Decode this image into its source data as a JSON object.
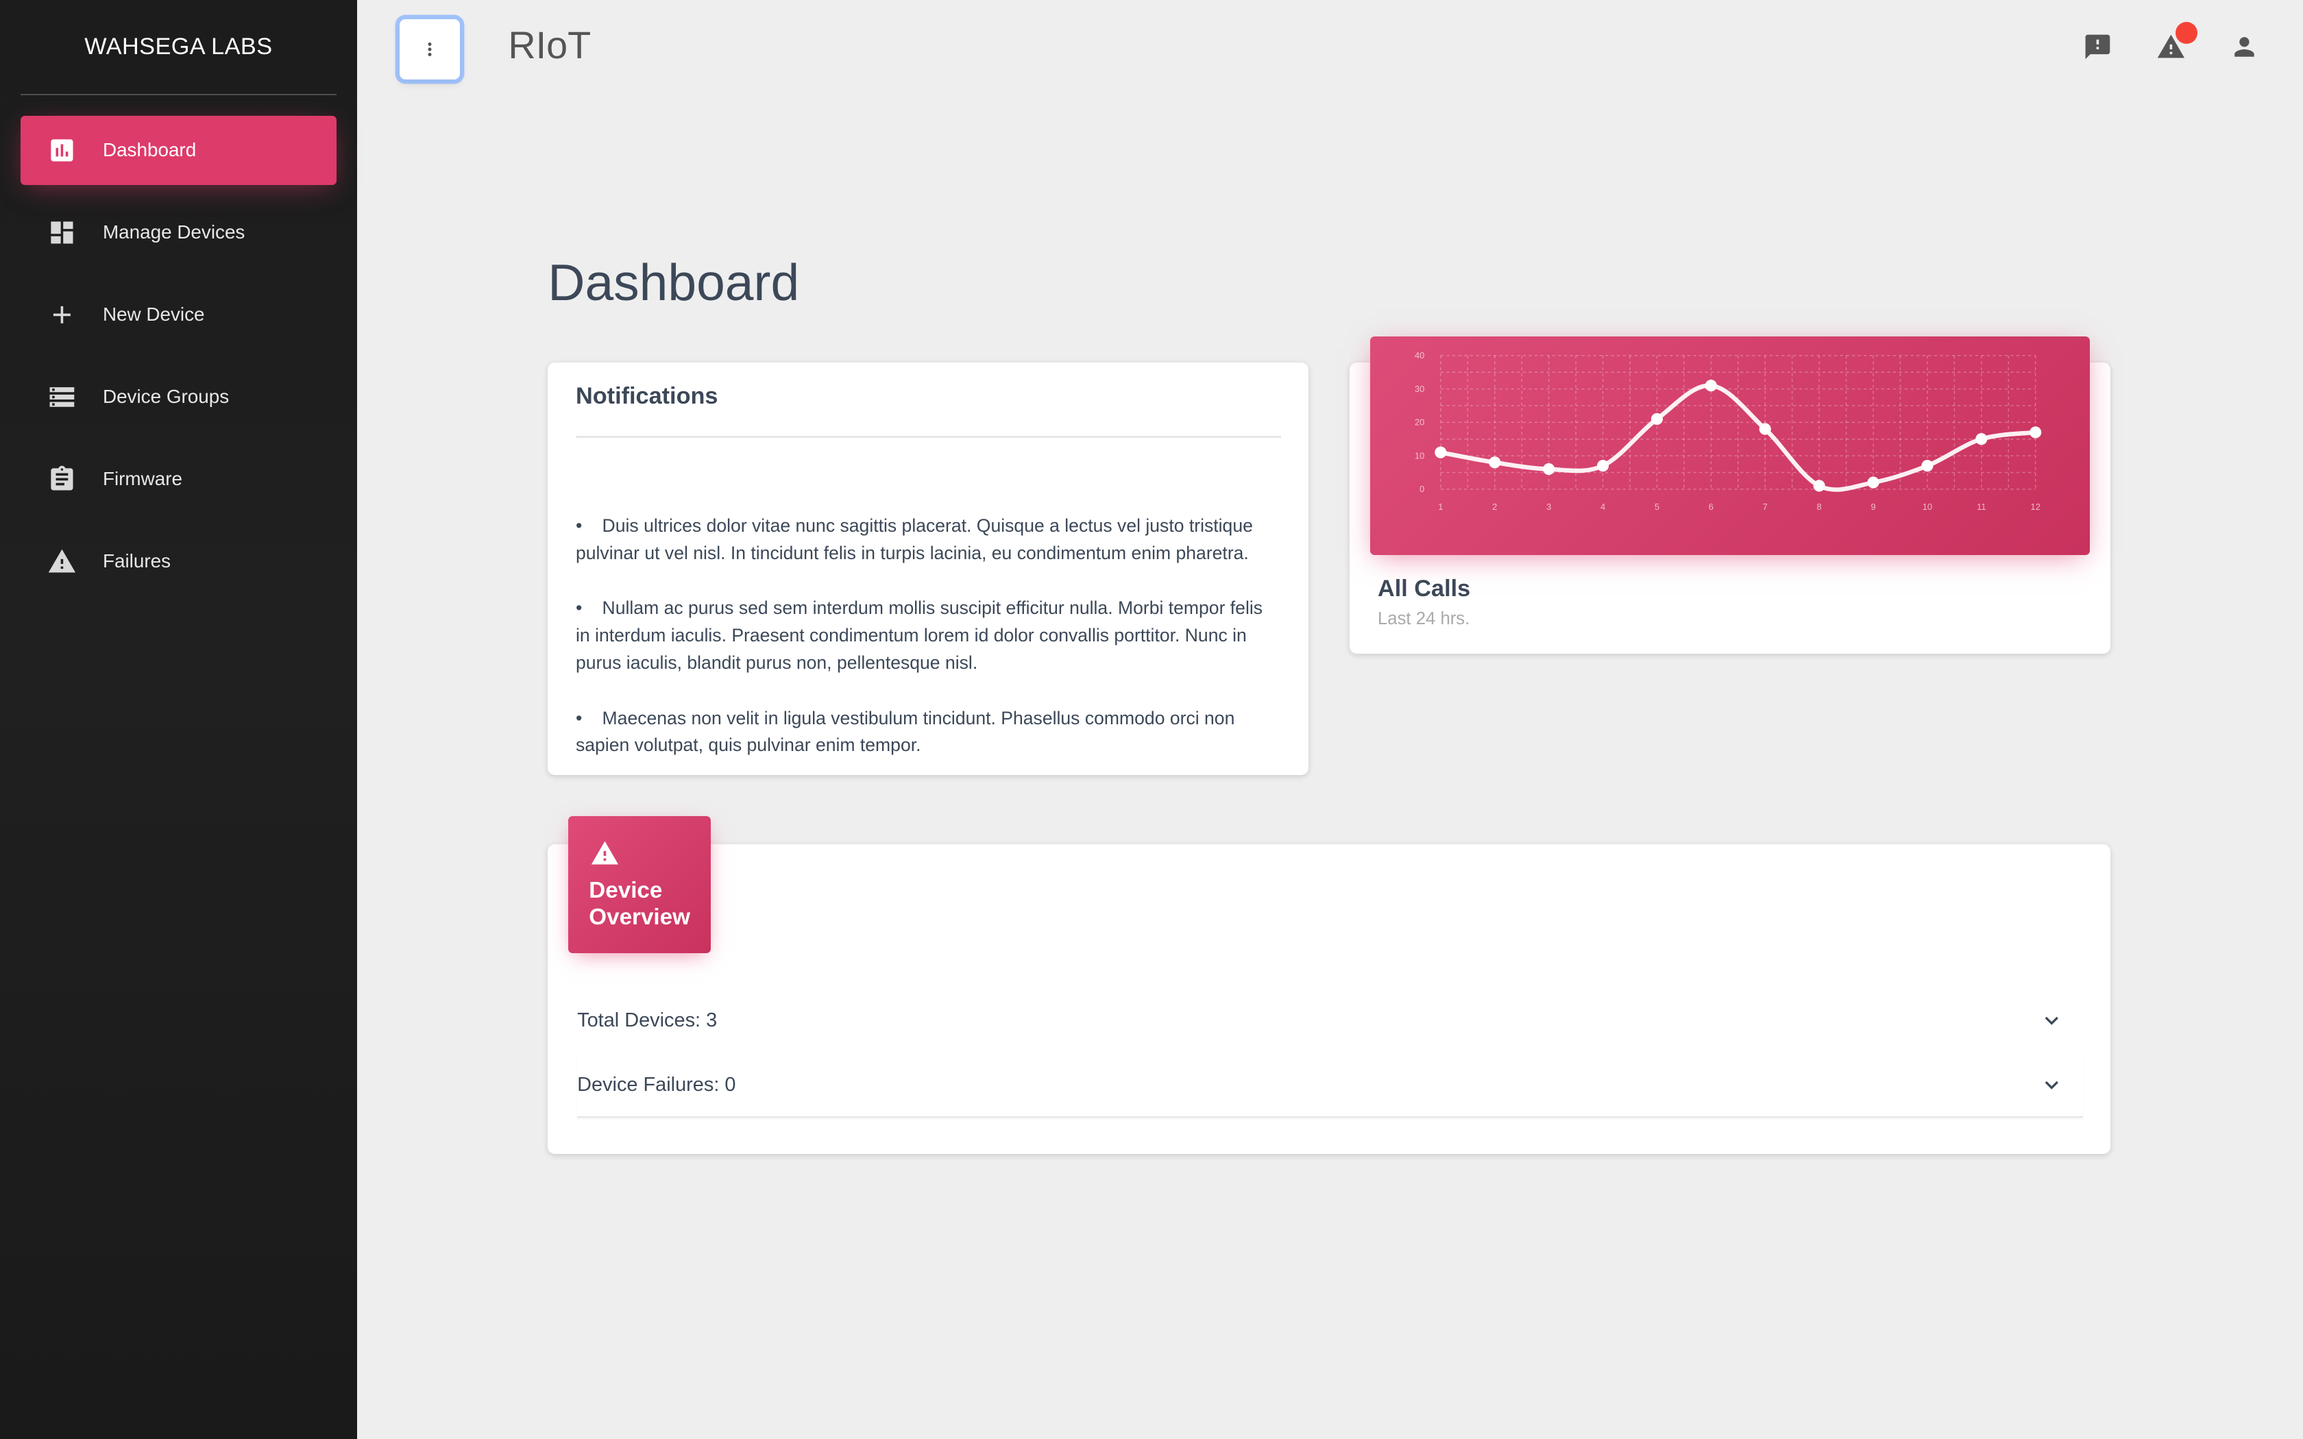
{
  "sidebar": {
    "brand": "WAHSEGA LABS",
    "items": [
      {
        "label": "Dashboard",
        "icon": "bar-chart-icon",
        "active": true
      },
      {
        "label": "Manage Devices",
        "icon": "dashboard-grid-icon",
        "active": false
      },
      {
        "label": "New Device",
        "icon": "plus-icon",
        "active": false
      },
      {
        "label": "Device Groups",
        "icon": "storage-icon",
        "active": false
      },
      {
        "label": "Firmware",
        "icon": "clipboard-icon",
        "active": false
      },
      {
        "label": "Failures",
        "icon": "warning-icon",
        "active": false
      }
    ]
  },
  "topbar": {
    "title": "RIoT",
    "icons": [
      "feedback-icon",
      "warning-icon",
      "person-icon"
    ],
    "alert_badge_color": "#f44336"
  },
  "page": {
    "title": "Dashboard"
  },
  "notifications": {
    "title": "Notifications",
    "items": [
      "Duis ultrices dolor vitae nunc sagittis placerat. Quisque a lectus vel justo tristique pulvinar ut vel nisl. In tincidunt felis in turpis lacinia, eu condimentum enim pharetra.",
      "Nullam ac purus sed sem interdum mollis suscipit efficitur nulla. Morbi tempor felis in interdum iaculis. Praesent condimentum lorem id dolor convallis porttitor. Nunc in purus iaculis, blandit purus non, pellentesque nisl.",
      "Maecenas non velit in ligula vestibulum tincidunt. Phasellus commodo orci non sapien volutpat, quis pulvinar enim tempor."
    ]
  },
  "calls": {
    "title": "All Calls",
    "subtitle": "Last 24 hrs."
  },
  "chart_data": {
    "type": "line",
    "x": [
      1,
      2,
      3,
      4,
      5,
      6,
      7,
      8,
      9,
      10,
      11,
      12
    ],
    "values": [
      11,
      8,
      6,
      7,
      21,
      31,
      18,
      1,
      2,
      7,
      15,
      17
    ],
    "ylim": [
      0,
      40
    ],
    "yticks": [
      0,
      10,
      20,
      30,
      40
    ],
    "grid": true,
    "title": "",
    "xlabel": "",
    "ylabel": ""
  },
  "overview": {
    "title": "Device Overview",
    "icon": "warning-icon",
    "rows": [
      {
        "label": "Total Devices: 3"
      },
      {
        "label": "Device Failures: 0"
      }
    ]
  },
  "colors": {
    "accent": "#dd3b6a",
    "sidebar_bg": "#1b1b1b",
    "page_bg": "#eeeeee"
  }
}
